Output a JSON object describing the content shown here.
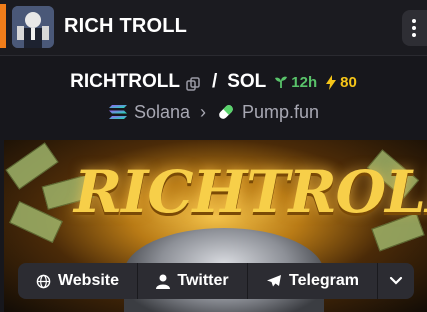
{
  "header": {
    "title": "RICH TROLL",
    "accent_color": "#f07d1a",
    "avatar_icon": "troll-avatar",
    "more_icon": "vertical-dots-icon"
  },
  "pair": {
    "base": "RICHTROLL",
    "separator": "/",
    "quote": "SOL",
    "age": "12h",
    "boost": "80",
    "age_color": "#59c36a",
    "boost_color": "#f5c518"
  },
  "route": {
    "chain": "Solana",
    "dex": "Pump.fun"
  },
  "banner": {
    "word": "RICHTROLL"
  },
  "links": {
    "website": "Website",
    "twitter": "Twitter",
    "telegram": "Telegram"
  }
}
